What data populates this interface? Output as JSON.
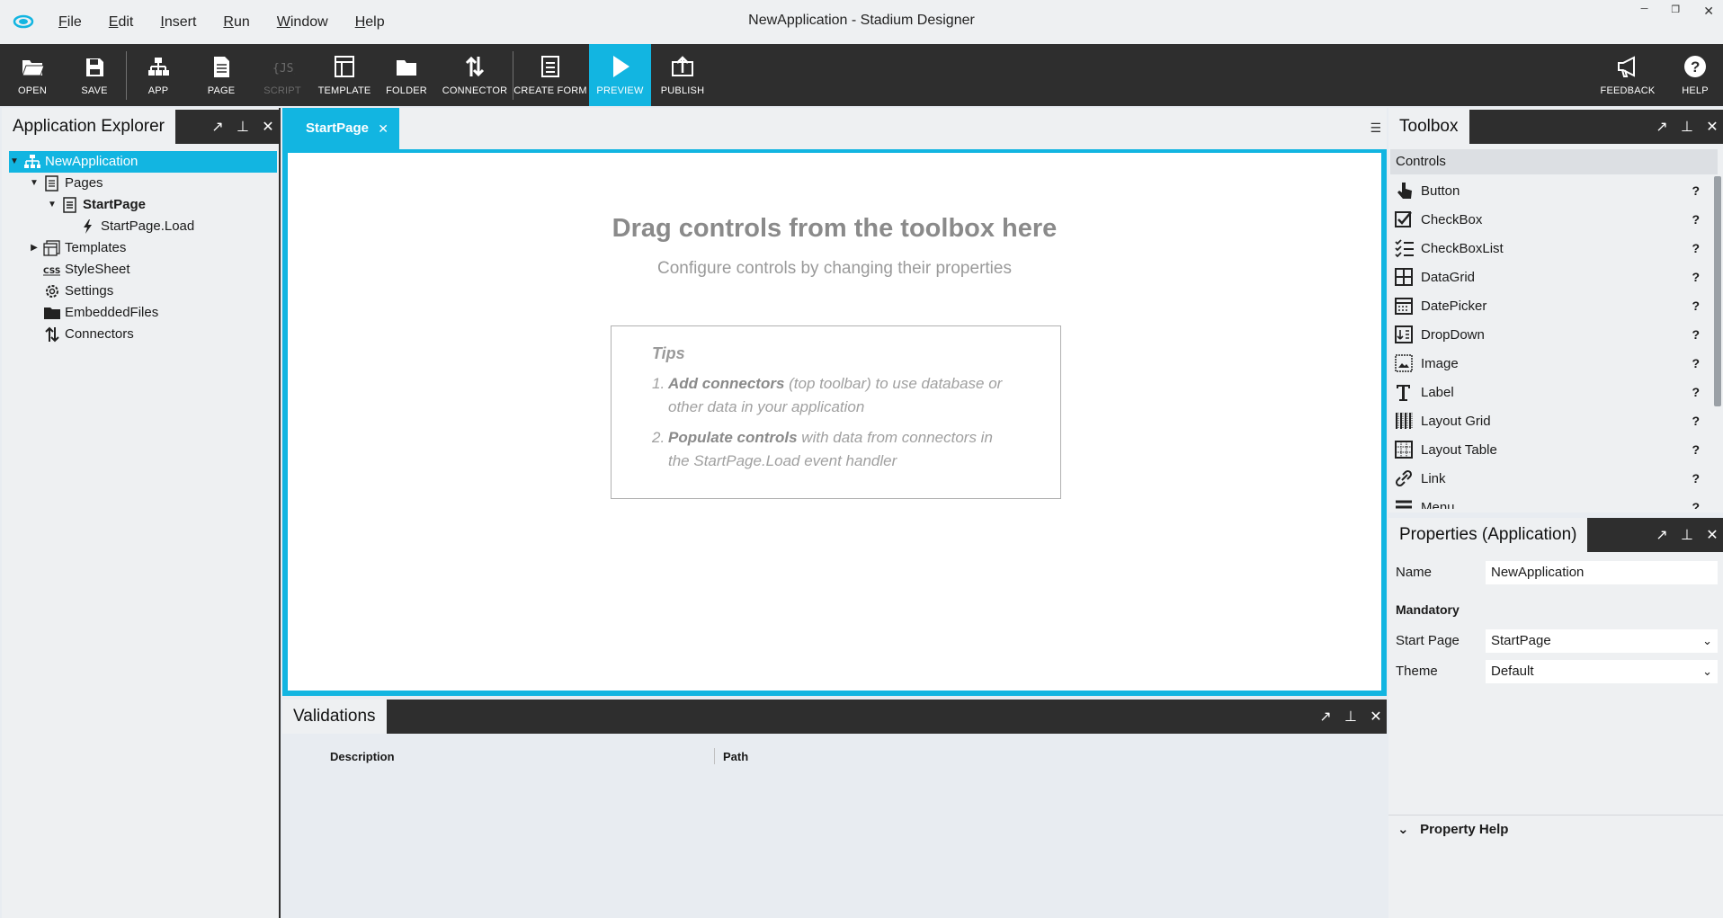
{
  "window": {
    "title": "NewApplication - Stadium Designer"
  },
  "menu": [
    "File",
    "Edit",
    "Insert",
    "Run",
    "Window",
    "Help"
  ],
  "ribbon": {
    "open": "OPEN",
    "save": "SAVE",
    "app": "APP",
    "page": "PAGE",
    "script": "SCRIPT",
    "template": "TEMPLATE",
    "folder": "FOLDER",
    "connector": "CONNECTOR",
    "create_form": "CREATE FORM",
    "preview": "PREVIEW",
    "publish": "PUBLISH",
    "feedback": "FEEDBACK",
    "help": "HELP",
    "active_color": "#12b5e1"
  },
  "explorer": {
    "title": "Application Explorer",
    "nodes": {
      "root": "NewApplication",
      "pages": "Pages",
      "start_page": "StartPage",
      "start_page_load": "StartPage.Load",
      "templates": "Templates",
      "stylesheet": "StyleSheet",
      "settings": "Settings",
      "embedded_files": "EmbeddedFiles",
      "connectors": "Connectors"
    }
  },
  "document": {
    "tab": "StartPage",
    "drag_title": "Drag controls from the toolbox here",
    "drag_subtitle": "Configure controls by changing their properties",
    "tips": {
      "title": "Tips",
      "tip1_num": "1.",
      "tip1_bold": "Add connectors",
      "tip1_rest": " (top toolbar) to use database or other data in your application",
      "tip2_num": "2.",
      "tip2_bold": "Populate controls",
      "tip2_rest": " with data from connectors in the StartPage.Load event handler"
    }
  },
  "validations": {
    "title": "Validations",
    "col_description": "Description",
    "col_path": "Path"
  },
  "toolbox": {
    "title": "Toolbox",
    "category": "Controls",
    "help_mark": "?",
    "items": [
      "Button",
      "CheckBox",
      "CheckBoxList",
      "DataGrid",
      "DatePicker",
      "DropDown",
      "Image",
      "Label",
      "Layout Grid",
      "Layout Table",
      "Link",
      "Menu"
    ]
  },
  "properties": {
    "title": "Properties (Application)",
    "name_label": "Name",
    "name_value": "NewApplication",
    "mandatory": "Mandatory",
    "start_page_label": "Start Page",
    "start_page_value": "StartPage",
    "theme_label": "Theme",
    "theme_value": "Default",
    "property_help": "Property Help"
  }
}
